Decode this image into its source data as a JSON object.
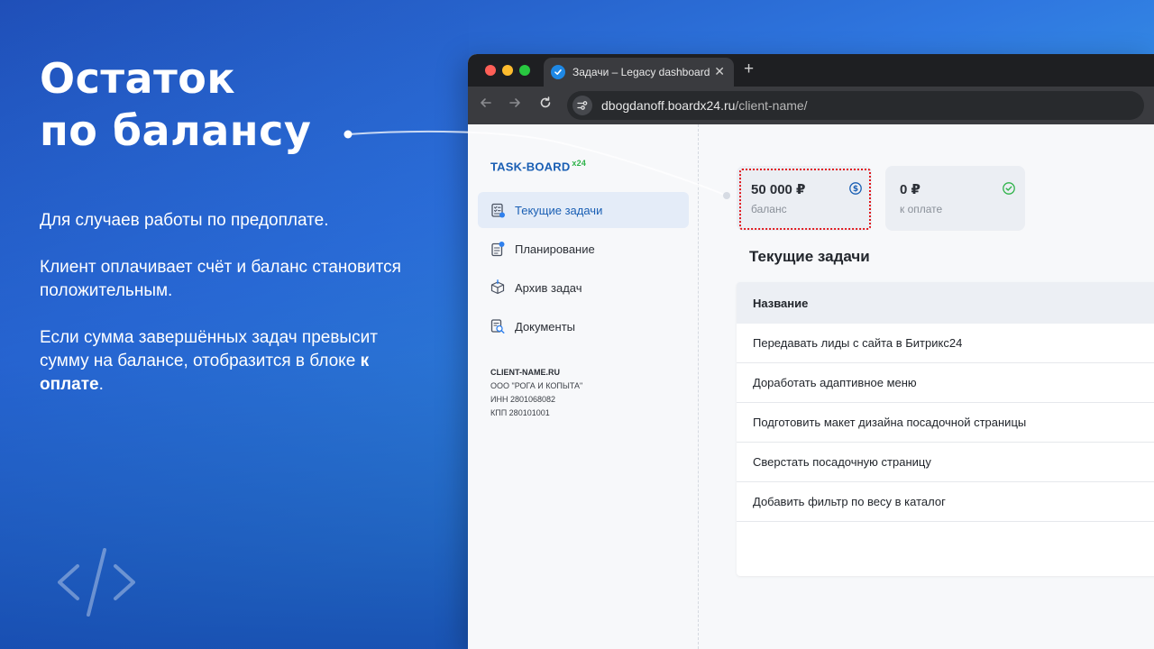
{
  "slide": {
    "headline_line1": "Остаток",
    "headline_line2": "по балансу",
    "paragraph1": "Для случаев работы по предоплате.",
    "paragraph2": "Клиент оплачивает счёт и баланс становится положительным.",
    "paragraph3_prefix": "Если сумма завершённых задач превысит сумму на балансе, отобразится в блоке ",
    "paragraph3_bold": "к оплате",
    "paragraph3_suffix": ".",
    "logo_icon": "code-brackets-icon"
  },
  "browser": {
    "tab_title": "Задачи – Legacy dashboard",
    "tab_close": "✕",
    "new_tab": "+",
    "url_host": "dbogdanoff.boardx24.ru",
    "url_path": "/client-name/"
  },
  "sidebar": {
    "brand": "TASK-BOARD",
    "brand_suffix": "x24",
    "items": [
      {
        "label": "Текущие задачи",
        "icon": "task-list-icon",
        "active": true
      },
      {
        "label": "Планирование",
        "icon": "planning-icon",
        "active": false
      },
      {
        "label": "Архив задач",
        "icon": "archive-box-icon",
        "active": false
      },
      {
        "label": "Документы",
        "icon": "documents-search-icon",
        "active": false
      }
    ],
    "client": {
      "domain": "CLIENT-NAME.RU",
      "company": "ООО \"РОГА И КОПЫТА\"",
      "inn": "ИНН 2801068082",
      "kpp": "КПП 280101001"
    }
  },
  "cards": {
    "balance": {
      "amount": "50 000 ₽",
      "caption": "баланс",
      "icon": "dollar-circle-icon"
    },
    "to_pay": {
      "amount": "0 ₽",
      "caption": "к оплате",
      "icon": "check-circle-icon"
    }
  },
  "tasks": {
    "title": "Текущие задачи",
    "column_header": "Название",
    "rows": [
      "Передавать лиды с сайта в Битрикс24",
      "Доработать адаптивное меню",
      "Подготовить макет дизайна посадочной страницы",
      "Сверстать посадочную страницу",
      "Добавить фильтр по весу в каталог"
    ]
  },
  "colors": {
    "accent_blue": "#1a5fb4",
    "brand_green": "#2fb34a",
    "highlight_red": "#e0161b"
  }
}
